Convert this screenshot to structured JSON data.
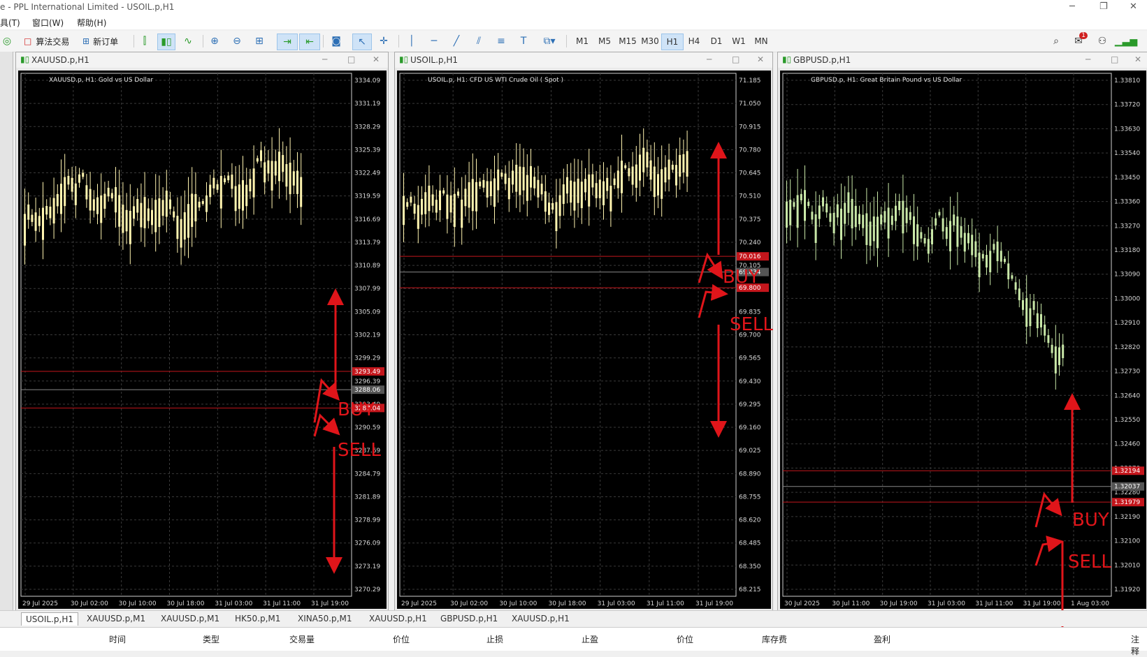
{
  "window": {
    "title": "e - PPL International Limited - USOIL.p,H1"
  },
  "menu": [
    "具(T)",
    "窗口(W)",
    "帮助(H)"
  ],
  "toolbar": {
    "algo_trading": "算法交易",
    "new_order": "新订单",
    "timeframes": [
      "M1",
      "M5",
      "M15",
      "M30",
      "H1",
      "H4",
      "D1",
      "W1",
      "MN"
    ],
    "active_tf": "H1",
    "alert_badge": "1"
  },
  "charts": [
    {
      "window_title": "XAUUSD.p,H1",
      "info": "XAUUSD.p, H1:  Gold vs US Dollar",
      "yticks": [
        "3334.09",
        "3331.19",
        "3328.29",
        "3325.39",
        "3322.49",
        "3319.59",
        "3316.69",
        "3313.79",
        "3310.89",
        "3307.99",
        "3305.09",
        "3302.19",
        "3299.29",
        "3296.39",
        "3293.49",
        "3290.59",
        "3287.69",
        "3284.79",
        "3281.89",
        "3278.99",
        "3276.09",
        "3273.19",
        "3270.29"
      ],
      "xticks": [
        "29 Jul 2025",
        "30 Jul 02:00",
        "30 Jul 10:00",
        "30 Jul 18:00",
        "31 Jul 03:00",
        "31 Jul 11:00",
        "31 Jul 19:00"
      ],
      "price_tags": [
        "3293.49",
        "3288.06",
        "3287.04"
      ]
    },
    {
      "window_title": "USOIL.p,H1",
      "info": "USOIL.p, H1:  CFD US WTI Crude Oil ( Spot )",
      "yticks": [
        "71.185",
        "71.050",
        "70.915",
        "70.780",
        "70.645",
        "70.510",
        "70.375",
        "70.240",
        "70.105",
        "69.970",
        "69.835",
        "69.700",
        "69.565",
        "69.430",
        "69.295",
        "69.160",
        "69.025",
        "68.890",
        "68.755",
        "68.620",
        "68.485",
        "68.350",
        "68.215"
      ],
      "xticks": [
        "29 Jul 2025",
        "30 Jul 02:00",
        "30 Jul 10:00",
        "30 Jul 18:00",
        "31 Jul 03:00",
        "31 Jul 11:00",
        "31 Jul 19:00"
      ],
      "price_tags": [
        "70.016",
        "69.834",
        "69.800"
      ]
    },
    {
      "window_title": "GBPUSD.p,H1",
      "info": "GBPUSD.p, H1:  Great Britain Pound vs US Dollar",
      "yticks": [
        "1.33810",
        "1.33720",
        "1.33630",
        "1.33540",
        "1.33450",
        "1.33360",
        "1.33270",
        "1.33180",
        "1.33090",
        "1.33000",
        "1.32910",
        "1.32820",
        "1.32730",
        "1.32640",
        "1.32550",
        "1.32460",
        "1.32370",
        "1.32280",
        "1.32190",
        "1.32100",
        "1.32010",
        "1.31920"
      ],
      "xticks": [
        "30 Jul 2025",
        "30 Jul 11:00",
        "30 Jul 19:00",
        "31 Jul 03:00",
        "31 Jul 11:00",
        "31 Jul 19:00",
        "1 Aug 03:00"
      ],
      "price_tags": [
        "1.32194",
        "1.32037",
        "1.31979"
      ]
    }
  ],
  "annotations": {
    "buy": "BUY",
    "sell": "SELL"
  },
  "tabs": [
    "USOIL.p,H1",
    "XAUUSD.p,M1",
    "XAUUSD.p,M1",
    "HK50.p,M1",
    "XINA50.p,M1",
    "XAUUSD.p,H1",
    "GBPUSD.p,H1",
    "XAUUSD.p,H1"
  ],
  "terminal_cols": [
    "时间",
    "类型",
    "交易量",
    "价位",
    "止损",
    "止盈",
    "价位",
    "库存费",
    "盈利",
    "注释"
  ],
  "colors": {
    "bull": "#fff4b0",
    "bear": "#c9e8a8",
    "annotation": "#e0151a",
    "grid": "#3a3a3a"
  }
}
